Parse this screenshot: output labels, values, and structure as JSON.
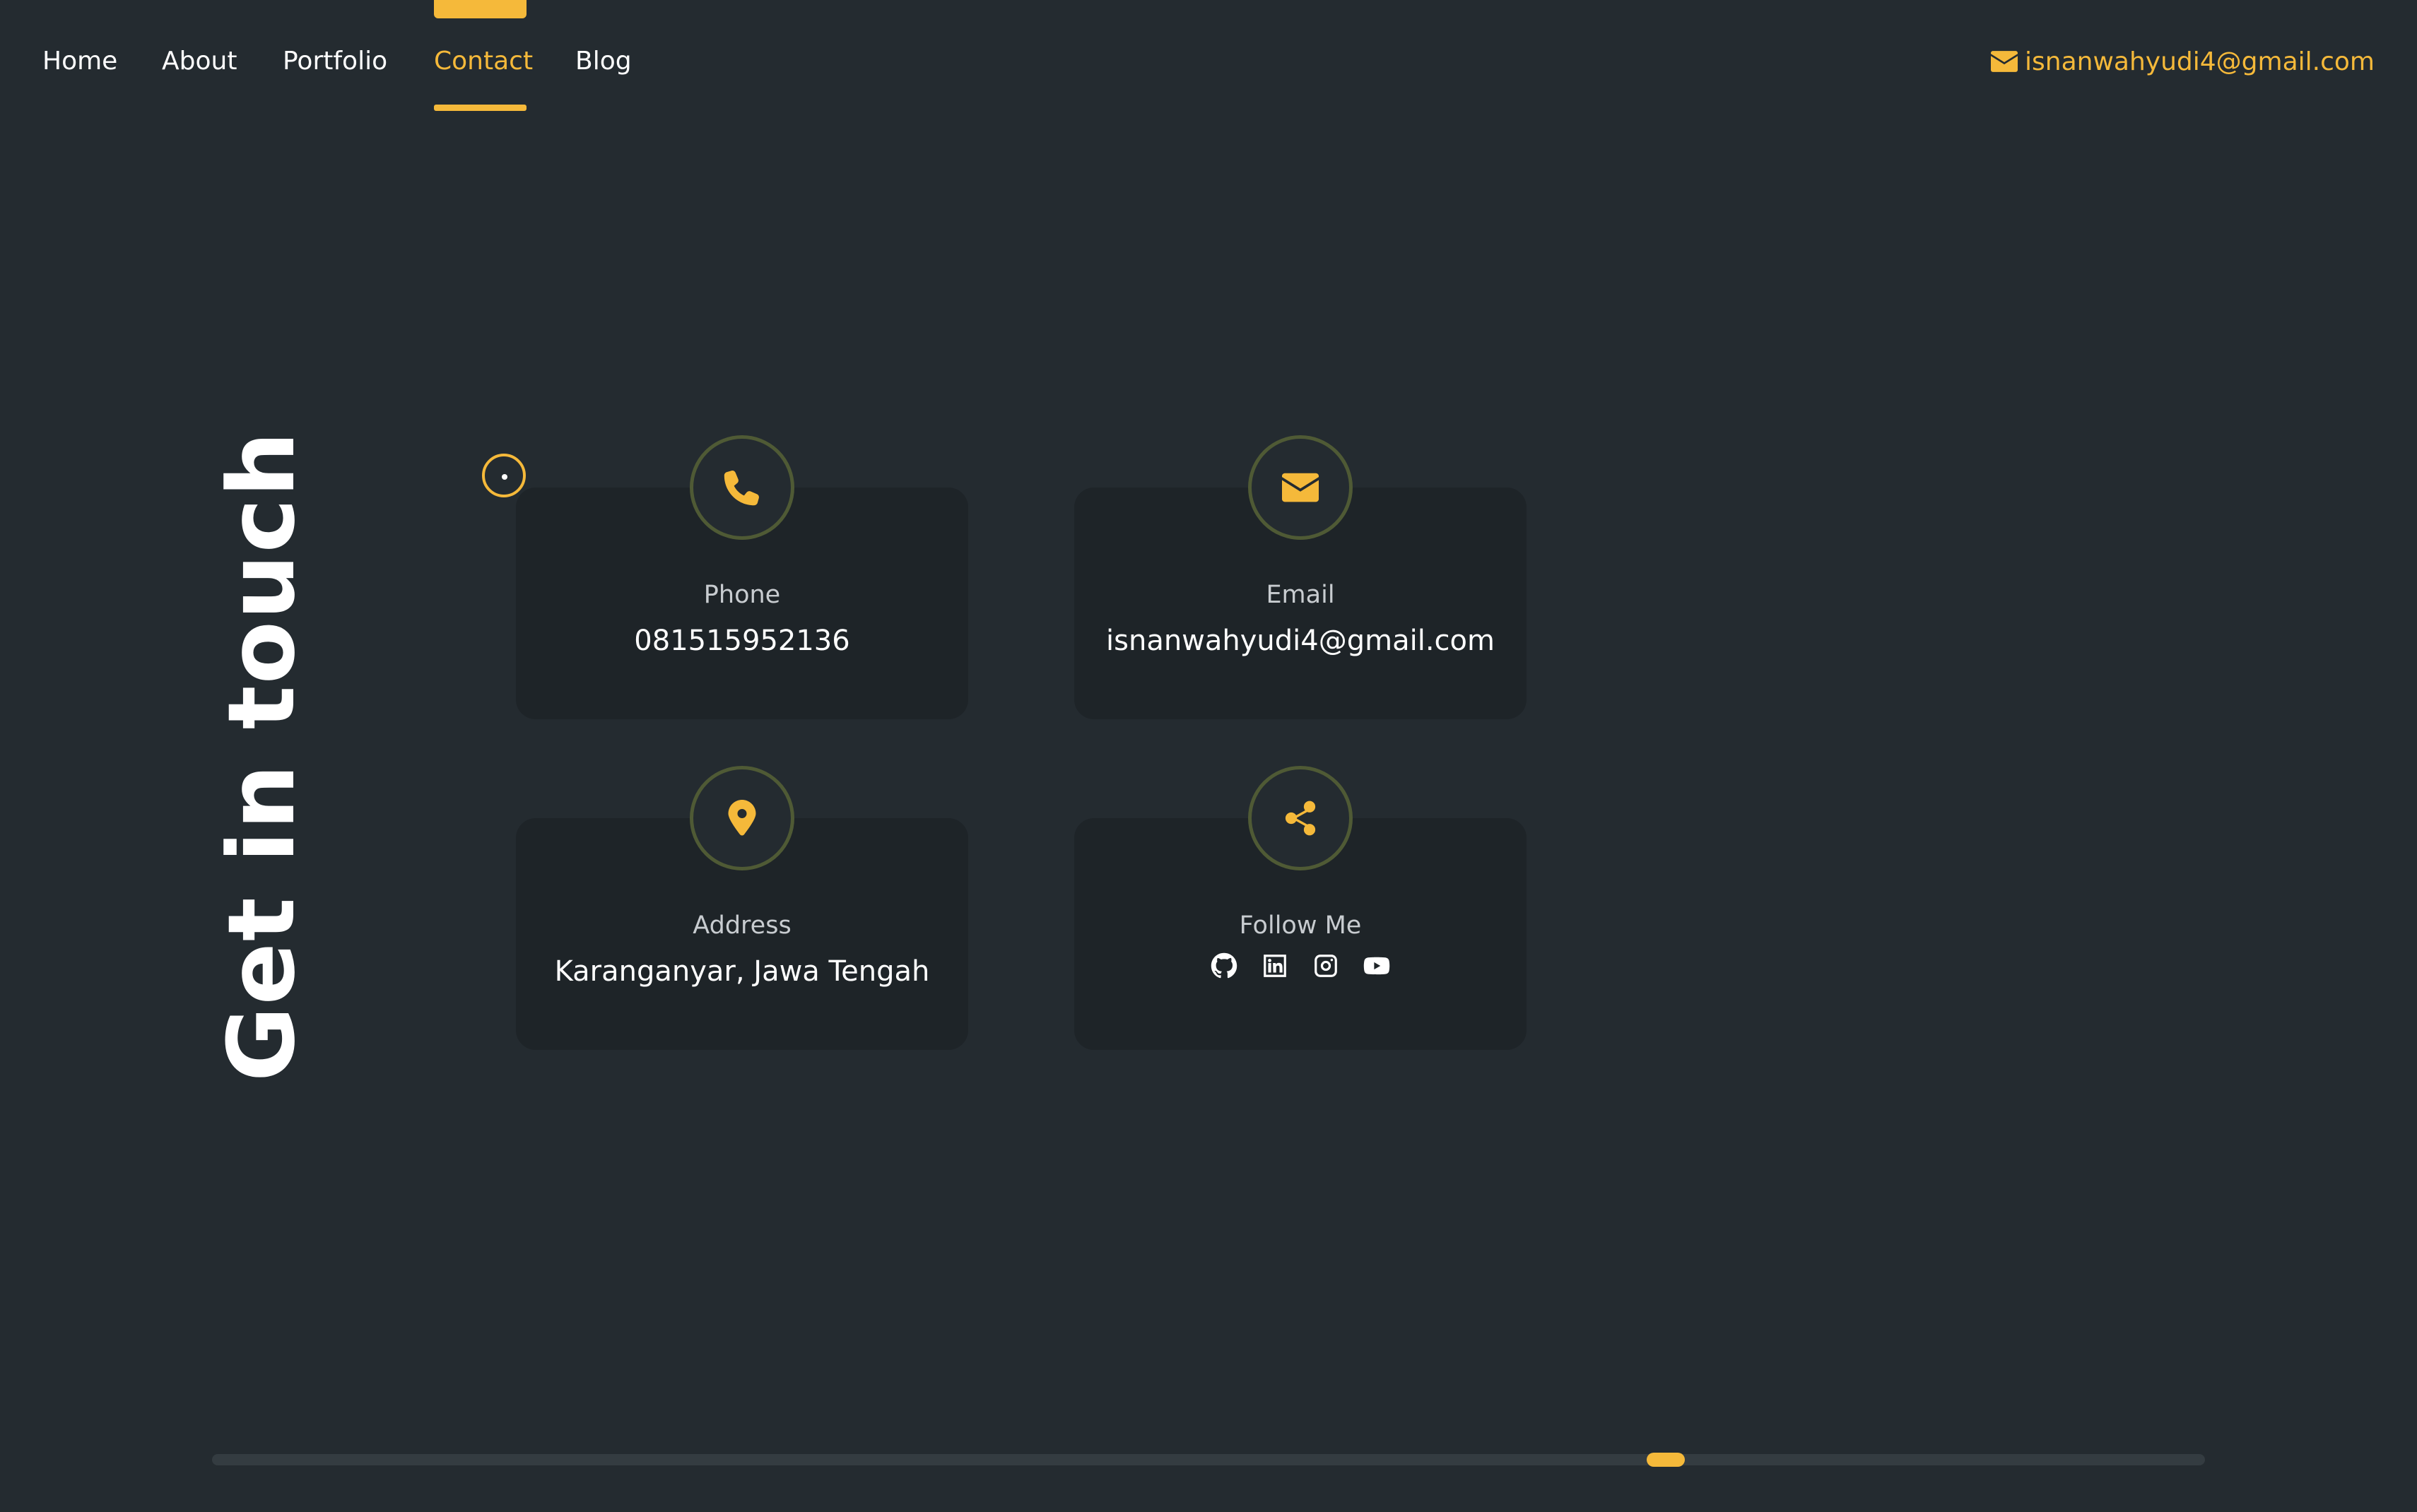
{
  "nav": {
    "items": [
      {
        "label": "Home",
        "active": false
      },
      {
        "label": "About",
        "active": false
      },
      {
        "label": "Portfolio",
        "active": false
      },
      {
        "label": "Contact",
        "active": true
      },
      {
        "label": "Blog",
        "active": false
      }
    ],
    "email": "isnanwahyudi4@gmail.com",
    "email_icon": "envelope-icon"
  },
  "section": {
    "title": "Get in touch"
  },
  "cards": {
    "phone": {
      "label": "Phone",
      "value": "081515952136",
      "icon": "phone-icon"
    },
    "email": {
      "label": "Email",
      "value": "isnanwahyudi4@gmail.com",
      "icon": "envelope-icon"
    },
    "address": {
      "label": "Address",
      "value": "Karanganyar, Jawa Tengah",
      "icon": "map-pin-icon"
    },
    "follow": {
      "label": "Follow Me",
      "icon": "share-icon",
      "socials": [
        "github-icon",
        "linkedin-icon",
        "instagram-icon",
        "youtube-icon"
      ]
    }
  },
  "colors": {
    "accent": "#f5b93a",
    "background": "#242b30",
    "card": "#1e2428"
  }
}
